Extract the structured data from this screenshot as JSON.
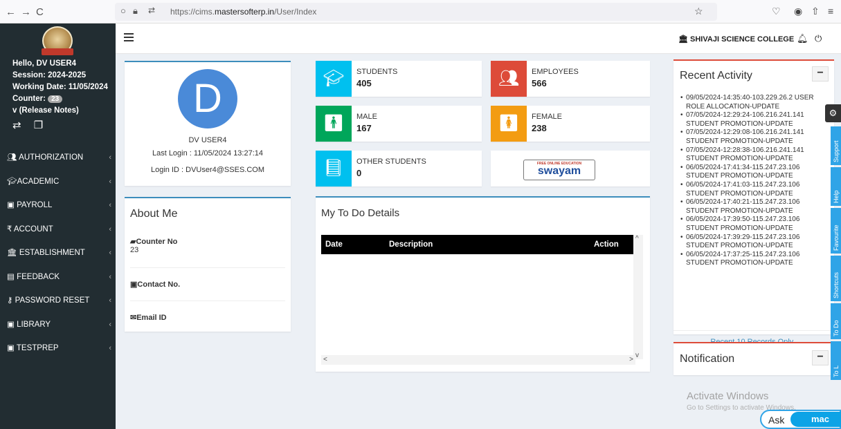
{
  "browser": {
    "url_host": "https://cims.",
    "url_domain": "mastersofterp.in",
    "url_path": "/User/Index",
    "back": "←",
    "forward": "→",
    "reload": "C"
  },
  "sidebar": {
    "greeting": "Hello, DV USER4",
    "session": "Session: 2024-2025",
    "working_date": "Working Date: 11/05/2024",
    "counter_label": "Counter:",
    "counter_value": "23",
    "release_notes": "v (Release Notes)",
    "menu": [
      {
        "label": "AUTHORIZATION",
        "icon": "users-icon"
      },
      {
        "label": "ACADEMIC",
        "icon": "graduation-cap-icon"
      },
      {
        "label": "PAYROLL",
        "icon": "money-icon"
      },
      {
        "label": "ACCOUNT",
        "icon": "rupee-icon"
      },
      {
        "label": "ESTABLISHMENT",
        "icon": "institution-icon"
      },
      {
        "label": "FEEDBACK",
        "icon": "comment-icon"
      },
      {
        "label": "PASSWORD RESET",
        "icon": "key-icon"
      },
      {
        "label": "LIBRARY",
        "icon": "book-icon"
      },
      {
        "label": "TESTPREP",
        "icon": "book-icon"
      }
    ]
  },
  "header": {
    "college": "SHIVAJI SCIENCE COLLEGE"
  },
  "profile": {
    "initial": "D",
    "name": "DV USER4",
    "last_login": "Last Login : 11/05/2024 13:27:14",
    "login_id": "Login ID : DVUser4@SSES.COM"
  },
  "about": {
    "title": "About Me",
    "counter_label": "Counter No",
    "counter_value": "23",
    "contact_label": "Contact No.",
    "email_label": "Email ID"
  },
  "stats": {
    "students_label": "STUDENTS",
    "students_value": "405",
    "employees_label": "EMPLOYEES",
    "employees_value": "566",
    "male_label": "MALE",
    "male_value": "167",
    "female_label": "FEMALE",
    "female_value": "238",
    "other_label": "OTHER STUDENTS",
    "other_value": "0",
    "swayam_tagline": "FREE ONLINE EDUCATION",
    "swayam_logo": "swayam",
    "colors": {
      "blue": "#00c0ef",
      "red": "#dd4b39",
      "green": "#00a65a",
      "orange": "#f39c12"
    }
  },
  "todo": {
    "title": "My To Do Details",
    "columns": [
      "Date",
      "Description",
      "Action"
    ]
  },
  "activity": {
    "title": "Recent Activity",
    "collapse": "−",
    "items": [
      "09/05/2024-14:35:40-103.229.26.2 USER ROLE ALLOCATION-UPDATE",
      "07/05/2024-12:29:24-106.216.241.141 STUDENT PROMOTION-UPDATE",
      "07/05/2024-12:29:08-106.216.241.141 STUDENT PROMOTION-UPDATE",
      "07/05/2024-12:28:38-106.216.241.141 STUDENT PROMOTION-UPDATE",
      "06/05/2024-17:41:34-115.247.23.106 STUDENT PROMOTION-UPDATE",
      "06/05/2024-17:41:03-115.247.23.106 STUDENT PROMOTION-UPDATE",
      "06/05/2024-17:40:21-115.247.23.106 STUDENT PROMOTION-UPDATE",
      "06/05/2024-17:39:50-115.247.23.106 STUDENT PROMOTION-UPDATE",
      "06/05/2024-17:39:29-115.247.23.106 STUDENT PROMOTION-UPDATE",
      "06/05/2024-17:37:25-115.247.23.106 STUDENT PROMOTION-UPDATE"
    ],
    "footer": "Recent 10 Records Only.."
  },
  "notification": {
    "title": "Notification",
    "collapse": "−"
  },
  "side_tabs": [
    "Support",
    "Help",
    "Favourite",
    "Shortcuts",
    "To Do",
    "To L"
  ],
  "watermark": {
    "line1": "Activate Windows",
    "line2": "Go to Settings to activate Windows."
  },
  "ask": {
    "label": "Ask",
    "brand": "mac"
  }
}
